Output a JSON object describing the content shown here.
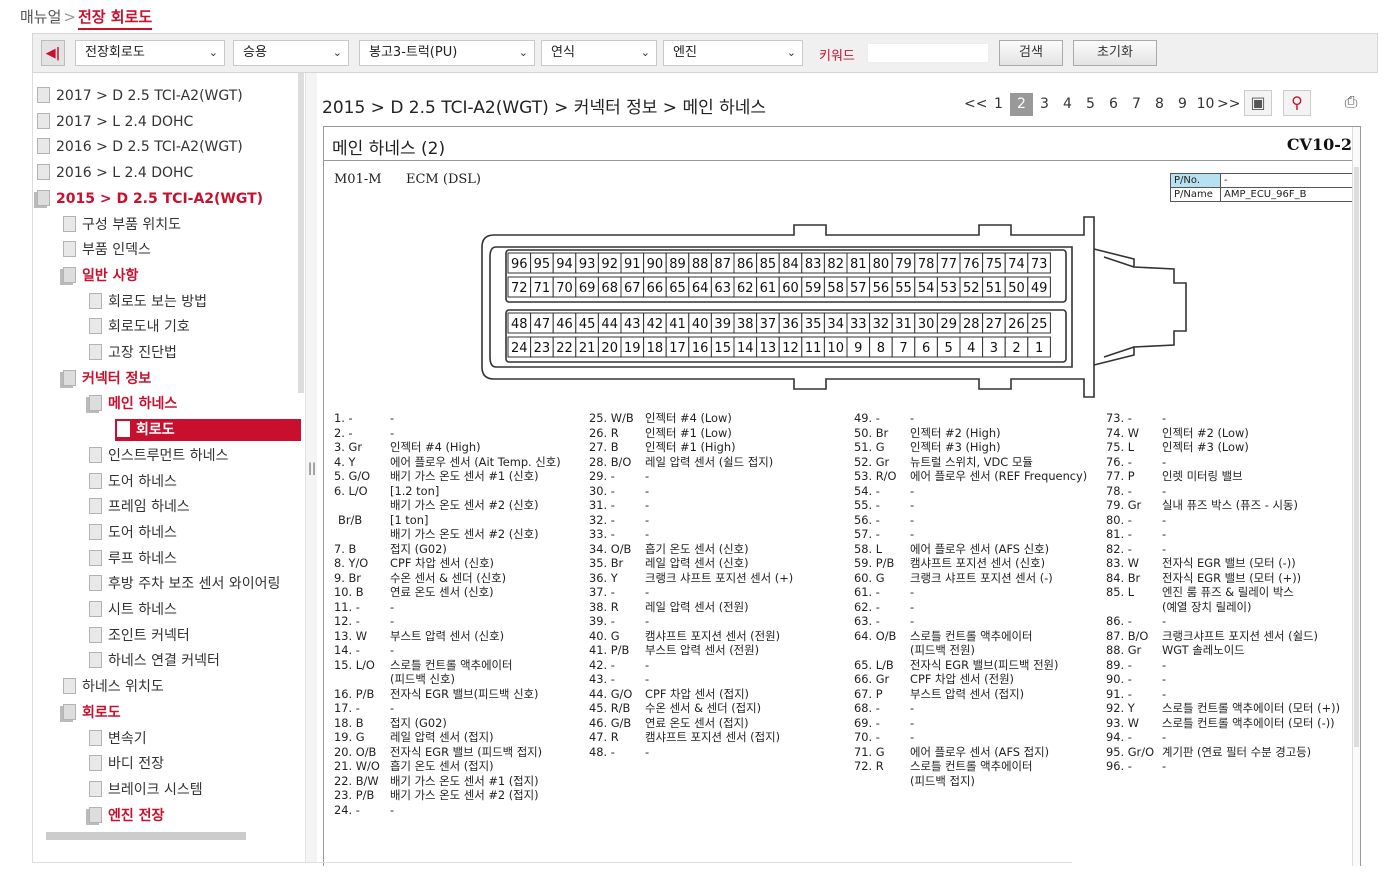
{
  "breadcrumb": {
    "root": "매뉴얼",
    "current": "전장 회로도"
  },
  "toolbar": {
    "category": "전장회로도",
    "type": "승용",
    "model": "봉고3-트럭(PU)",
    "year": "연식",
    "engine": "엔진",
    "keyword_label": "키워드",
    "keyword_value": "",
    "search": "검색",
    "reset": "초기화"
  },
  "tree": [
    {
      "label": "2017 > D 2.5 TCI-A2(WGT)",
      "level": 0,
      "style": "normal"
    },
    {
      "label": "2017 > L 2.4 DOHC",
      "level": 0,
      "style": "normal"
    },
    {
      "label": "2016 > D 2.5 TCI-A2(WGT)",
      "level": 0,
      "style": "normal"
    },
    {
      "label": "2016 > L 2.4 DOHC",
      "level": 0,
      "style": "normal"
    },
    {
      "label": "2015 > D 2.5 TCI-A2(WGT)",
      "level": 0,
      "style": "red"
    },
    {
      "label": "구성 부품 위치도",
      "level": 1,
      "style": "normal"
    },
    {
      "label": "부품 인덱스",
      "level": 1,
      "style": "normal"
    },
    {
      "label": "일반 사항",
      "level": 1,
      "style": "red"
    },
    {
      "label": "회로도 보는 방법",
      "level": 2,
      "style": "normal"
    },
    {
      "label": "회로도내 기호",
      "level": 2,
      "style": "normal"
    },
    {
      "label": "고장 진단법",
      "level": 2,
      "style": "normal"
    },
    {
      "label": "커넥터 정보",
      "level": 1,
      "style": "red"
    },
    {
      "label": "메인 하네스",
      "level": 2,
      "style": "red"
    },
    {
      "label": "회로도",
      "level": 3,
      "style": "selected"
    },
    {
      "label": "인스트루먼트 하네스",
      "level": 2,
      "style": "normal"
    },
    {
      "label": "도어 하네스",
      "level": 2,
      "style": "normal"
    },
    {
      "label": "프레임 하네스",
      "level": 2,
      "style": "normal"
    },
    {
      "label": "도어 하네스",
      "level": 2,
      "style": "normal"
    },
    {
      "label": "루프 하네스",
      "level": 2,
      "style": "normal"
    },
    {
      "label": "후방 주차 보조 센서 와이어링",
      "level": 2,
      "style": "normal"
    },
    {
      "label": "시트 하네스",
      "level": 2,
      "style": "normal"
    },
    {
      "label": "조인트 커넥터",
      "level": 2,
      "style": "normal"
    },
    {
      "label": "하네스 연결 커넥터",
      "level": 2,
      "style": "normal"
    },
    {
      "label": "하네스 위치도",
      "level": 1,
      "style": "normal"
    },
    {
      "label": "회로도",
      "level": 1,
      "style": "red"
    },
    {
      "label": "변속기",
      "level": 2,
      "style": "normal"
    },
    {
      "label": "바디 전장",
      "level": 2,
      "style": "normal"
    },
    {
      "label": "브레이크 시스템",
      "level": 2,
      "style": "normal"
    },
    {
      "label": "엔진 전장",
      "level": 2,
      "style": "red"
    }
  ],
  "main": {
    "path": "2015 > D 2.5 TCI-A2(WGT) > 커넥터 정보 > 메인 하네스",
    "pager": [
      "<<",
      "1",
      "2",
      "3",
      "4",
      "5",
      "6",
      "7",
      "8",
      "9",
      "10",
      ">>"
    ],
    "current_page": "2",
    "doc_title": "메인 하네스 (2)",
    "doc_code": "CV10-2",
    "connector_code": "M01-M",
    "connector_name": "ECM (DSL)",
    "pno_label": "P/No.",
    "pno_value": "-",
    "pname_label": "P/Name",
    "pname_value": "AMP_ECU_96F_B"
  },
  "pin_rows": [
    [
      "96",
      "95",
      "94",
      "93",
      "92",
      "91",
      "90",
      "89",
      "88",
      "87",
      "86",
      "85",
      "84",
      "83",
      "82",
      "81",
      "80",
      "79",
      "78",
      "77",
      "76",
      "75",
      "74",
      "73"
    ],
    [
      "72",
      "71",
      "70",
      "69",
      "68",
      "67",
      "66",
      "65",
      "64",
      "63",
      "62",
      "61",
      "60",
      "59",
      "58",
      "57",
      "56",
      "55",
      "54",
      "53",
      "52",
      "51",
      "50",
      "49"
    ],
    [
      "48",
      "47",
      "46",
      "45",
      "44",
      "43",
      "42",
      "41",
      "40",
      "39",
      "38",
      "37",
      "36",
      "35",
      "34",
      "33",
      "32",
      "31",
      "30",
      "29",
      "28",
      "27",
      "26",
      "25"
    ],
    [
      "24",
      "23",
      "22",
      "21",
      "20",
      "19",
      "18",
      "17",
      "16",
      "15",
      "14",
      "13",
      "12",
      "11",
      "10",
      "9",
      "8",
      "7",
      "6",
      "5",
      "4",
      "3",
      "2",
      "1"
    ]
  ],
  "pin_columns": [
    [
      [
        "1. -",
        "-"
      ],
      [
        "2. -",
        "-"
      ],
      [
        "3. Gr",
        "인젝터 #4 (High)"
      ],
      [
        "4. Y",
        "에어 플로우 센서 (Ait Temp. 신호)"
      ],
      [
        "5. G/O",
        "배기 가스 온도 센서 #1 (신호)"
      ],
      [
        "6. L/O",
        "[1.2 ton]"
      ],
      [
        "",
        "배기 가스 온도 센서 #2 (신호)"
      ],
      [
        "Br/B",
        "[1 ton]"
      ],
      [
        "",
        "배기 가스 온도 센서 #2 (신호)"
      ],
      [
        "7. B",
        "접지 (G02)"
      ],
      [
        "8. Y/O",
        "CPF 차압 센서 (신호)"
      ],
      [
        "9. Br",
        "수온 센서 & 센더 (신호)"
      ],
      [
        "10. B",
        "연료 온도 센서 (신호)"
      ],
      [
        "11. -",
        "-"
      ],
      [
        "12. -",
        "-"
      ],
      [
        "13. W",
        "부스트 압력 센서 (신호)"
      ],
      [
        "14. -",
        "-"
      ],
      [
        "15. L/O",
        "스로틀 컨트롤 액추에이터"
      ],
      [
        "",
        "(피드백 신호)"
      ],
      [
        "16. P/B",
        "전자식 EGR 밸브(피드백 신호)"
      ],
      [
        "17. -",
        "-"
      ],
      [
        "18. B",
        "접지 (G02)"
      ],
      [
        "19. G",
        "레일 압력 센서 (접지)"
      ],
      [
        "20. O/B",
        "전자식 EGR 밸브 (피드백 접지)"
      ],
      [
        "21. W/O",
        "흡기 온도 센서 (접지)"
      ],
      [
        "22. B/W",
        "배기 가스 온도 센서 #1 (접지)"
      ],
      [
        "23. P/B",
        "배기 가스 온도 센서 #2 (접지)"
      ],
      [
        "24. -",
        "-"
      ]
    ],
    [
      [
        "25. W/B",
        "인젝터 #4 (Low)"
      ],
      [
        "26. R",
        "인젝터 #1 (Low)"
      ],
      [
        "27. B",
        "인젝터 #1 (High)"
      ],
      [
        "28. B/O",
        "레일 압력 센서 (쉴드 접지)"
      ],
      [
        "29. -",
        "-"
      ],
      [
        "30. -",
        "-"
      ],
      [
        "31. -",
        "-"
      ],
      [
        "32. -",
        "-"
      ],
      [
        "33. -",
        "-"
      ],
      [
        "34. O/B",
        "흡기 온도 센서 (신호)"
      ],
      [
        "35. Br",
        "레일 압력 센서 (신호)"
      ],
      [
        "36. Y",
        "크랭크 샤프트 포지션 센서 (+)"
      ],
      [
        "37. -",
        "-"
      ],
      [
        "38. R",
        "레일 압력 센서 (전원)"
      ],
      [
        "39. -",
        "-"
      ],
      [
        "40. G",
        "캠샤프트 포지션 센서 (전원)"
      ],
      [
        "41. P/B",
        "부스트 압력 센서 (전원)"
      ],
      [
        "42. -",
        "-"
      ],
      [
        "43. -",
        "-"
      ],
      [
        "44. G/O",
        "CPF 차압 센서 (접지)"
      ],
      [
        "45. R/B",
        "수온 센서 & 센더 (접지)"
      ],
      [
        "46. G/B",
        "연료 온도 센서 (접지)"
      ],
      [
        "47. R",
        "캠샤프트 포지션 센서 (접지)"
      ],
      [
        "48. -",
        "-"
      ]
    ],
    [
      [
        "49. -",
        "-"
      ],
      [
        "50. Br",
        "인젝터 #2 (High)"
      ],
      [
        "51. G",
        "인젝터 #3 (High)"
      ],
      [
        "52. Gr",
        "뉴트럴 스위치, VDC 모듈"
      ],
      [
        "53. R/O",
        "에어 플로우 센서 (REF Frequency)"
      ],
      [
        "54. -",
        "-"
      ],
      [
        "55. -",
        "-"
      ],
      [
        "56. -",
        "-"
      ],
      [
        "57. -",
        "-"
      ],
      [
        "58. L",
        "에어 플로우 센서 (AFS 신호)"
      ],
      [
        "59. P/B",
        "캠샤프트 포지션 센서 (신호)"
      ],
      [
        "60. G",
        "크랭크 샤프트 포지션 센서 (-)"
      ],
      [
        "61. -",
        "-"
      ],
      [
        "62. -",
        "-"
      ],
      [
        "63. -",
        "-"
      ],
      [
        "64. O/B",
        "스로틀 컨트롤 액추에이터"
      ],
      [
        "",
        "(피드백 전원)"
      ],
      [
        "65. L/B",
        "전자식 EGR 밸브(피드백 전원)"
      ],
      [
        "66. Gr",
        "CPF 차압 센서 (전원)"
      ],
      [
        "67. P",
        "부스트 압력 센서 (접지)"
      ],
      [
        "68. -",
        "-"
      ],
      [
        "69. -",
        "-"
      ],
      [
        "70. -",
        "-"
      ],
      [
        "71. G",
        "에어 플로우 센서 (AFS 접지)"
      ],
      [
        "72. R",
        "스로틀 컨트롤 액추에이터"
      ],
      [
        "",
        "(피드백 접지)"
      ]
    ],
    [
      [
        "73. -",
        "-"
      ],
      [
        "74. W",
        "인젝터 #2 (Low)"
      ],
      [
        "75. L",
        "인젝터 #3 (Low)"
      ],
      [
        "76. -",
        "-"
      ],
      [
        "77. P",
        "인렛 미터링 밸브"
      ],
      [
        "78. -",
        "-"
      ],
      [
        "79. Gr",
        "실내 퓨즈 박스 (퓨즈 - 시동)"
      ],
      [
        "80. -",
        "-"
      ],
      [
        "81. -",
        "-"
      ],
      [
        "82. -",
        "-"
      ],
      [
        "83. W",
        "전자식 EGR 밸브 (모터 (-))"
      ],
      [
        "84. Br",
        "전자식 EGR 밸브 (모터 (+))"
      ],
      [
        "85. L",
        "엔진 룸 퓨즈 & 릴레이 박스"
      ],
      [
        "",
        "(예열 장치 릴레이)"
      ],
      [
        "86. -",
        "-"
      ],
      [
        "87. B/O",
        "크랭크샤프트 포지션 센서 (쉴드)"
      ],
      [
        "88. Gr",
        "WGT 솔레노이드"
      ],
      [
        "89. -",
        "-"
      ],
      [
        "90. -",
        "-"
      ],
      [
        "91. -",
        "-"
      ],
      [
        "92. Y",
        "스로틀 컨트롤 액추에이터 (모터 (+))"
      ],
      [
        "93. W",
        "스로틀 컨트롤 액추에이터 (모터 (-))"
      ],
      [
        "94. -",
        "-"
      ],
      [
        "95. Gr/O",
        "계기판 (연료 필터 수분 경고등)"
      ],
      [
        "96. -",
        "-"
      ]
    ]
  ],
  "colors": {
    "accent": "#c8102e",
    "selected_page": "#999999",
    "pname_header": "#b7e1f0"
  }
}
